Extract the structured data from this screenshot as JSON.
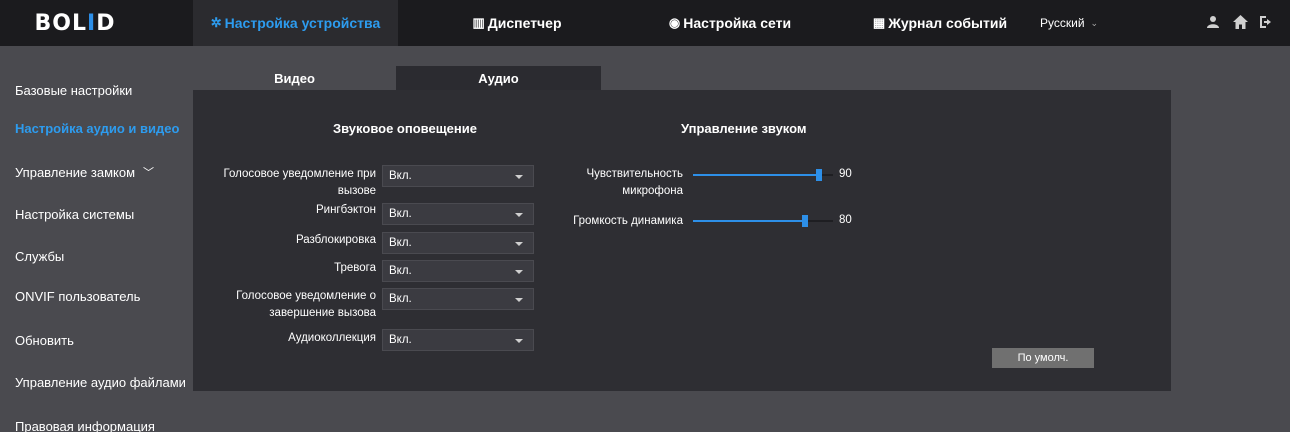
{
  "header": {
    "logo": {
      "pre": "BOL",
      "accent": "I",
      "post": "D"
    },
    "nav": [
      {
        "label": "Настройка устройства",
        "icon": "gear-icon"
      },
      {
        "label": "Диспетчер",
        "icon": "building-icon"
      },
      {
        "label": "Настройка сети",
        "icon": "globe-icon"
      },
      {
        "label": "Журнал событий",
        "icon": "log-icon"
      }
    ],
    "language": "Русский",
    "icons": [
      "user-icon",
      "home-icon",
      "logout-icon"
    ]
  },
  "sidebar": {
    "items": [
      {
        "label": "Базовые настройки"
      },
      {
        "label": "Настройка аудио и видео"
      },
      {
        "label": "Управление замком"
      },
      {
        "label": "Настройка системы"
      },
      {
        "label": "Службы"
      },
      {
        "label": "ONVIF пользователь"
      },
      {
        "label": "Обновить"
      },
      {
        "label": "Управление аудио файлами"
      },
      {
        "label": "Правовая информация"
      }
    ]
  },
  "tabs": [
    {
      "label": "Видео"
    },
    {
      "label": "Аудио"
    }
  ],
  "sound_alerts": {
    "title": "Звуковое оповещение",
    "rows": [
      {
        "label_line1": "Голосовое уведомление при",
        "label_line2": "вызове",
        "value": "Вкл."
      },
      {
        "label_line1": "Рингбэктон",
        "label_line2": "",
        "value": "Вкл."
      },
      {
        "label_line1": "Разблокировка",
        "label_line2": "",
        "value": "Вкл."
      },
      {
        "label_line1": "Тревога",
        "label_line2": "",
        "value": "Вкл."
      },
      {
        "label_line1": "Голосовое уведомление о",
        "label_line2": "завершение вызова",
        "value": "Вкл."
      },
      {
        "label_line1": "Аудиоколлекция",
        "label_line2": "",
        "value": "Вкл."
      }
    ]
  },
  "sound_control": {
    "title": "Управление звуком",
    "sliders": [
      {
        "label_line1": "Чувствительность",
        "label_line2": "микрофона",
        "value": "90",
        "fraction": 0.9
      },
      {
        "label_line1": "Громкость динамика",
        "label_line2": "",
        "value": "80",
        "fraction": 0.8
      }
    ]
  },
  "default_button": "По умолч.",
  "colors": {
    "accent": "#2d9cef",
    "panel": "#2e2e33",
    "background": "#4a4a4f",
    "topbar": "#1b1b1e"
  }
}
